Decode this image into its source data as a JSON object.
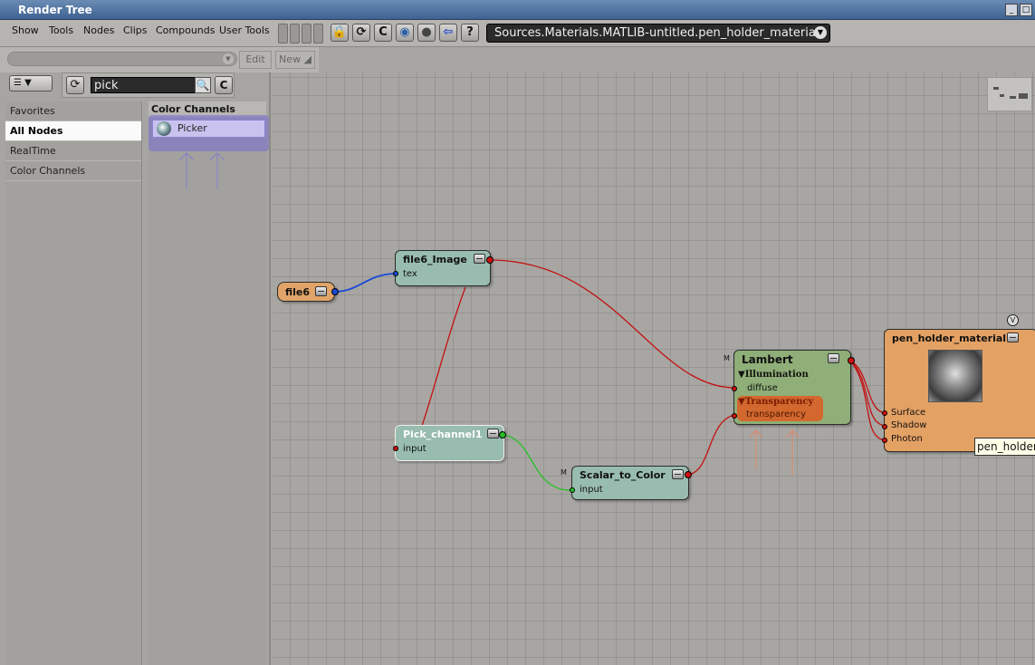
{
  "window": {
    "title": "Render Tree",
    "controls": [
      "_",
      "□"
    ]
  },
  "menu": [
    "Show",
    "Tools",
    "Nodes",
    "Clips",
    "Compounds",
    "User Tools"
  ],
  "toolbar": {
    "icons": [
      {
        "name": "lock-icon",
        "glyph": "🔒"
      },
      {
        "name": "refresh-icon",
        "glyph": "⟳"
      },
      {
        "name": "clear-icon",
        "glyph": "C"
      },
      {
        "name": "material-sphere-icon",
        "glyph": "◉"
      },
      {
        "name": "render-apple-icon",
        "glyph": "●"
      },
      {
        "name": "back-arrow-icon",
        "glyph": "⇦"
      },
      {
        "name": "help-icon",
        "glyph": "?"
      }
    ],
    "path": "Sources.Materials.MATLIB-untitled.pen_holder_material",
    "path_dropdown": "▼"
  },
  "toolbar2": {
    "edit_label": "Edit",
    "new_label": "New ◢",
    "combo_dropdown": "▼"
  },
  "preset_panel": {
    "list_mode_glyph": "☰ ▼",
    "search": {
      "value": "pick",
      "search_glyph": "🔍",
      "clear_glyph": "C",
      "refresh_glyph": "⟳"
    },
    "categories": [
      {
        "label": "Favorites",
        "selected": false
      },
      {
        "label": "All Nodes",
        "selected": true
      },
      {
        "label": "RealTime",
        "selected": false
      },
      {
        "label": "Color Channels",
        "selected": false
      }
    ],
    "node_group": {
      "header": "Color Channels",
      "items": [
        {
          "label": "Picker"
        }
      ]
    }
  },
  "graph": {
    "nodes": {
      "file6": {
        "title": "file6"
      },
      "file6_image": {
        "title": "file6_Image",
        "ports": {
          "tex": "tex"
        }
      },
      "pick_channel1": {
        "title": "Pick_channel1",
        "ports": {
          "input": "input"
        }
      },
      "scalar_to_color": {
        "title": "Scalar_to_Color",
        "ports": {
          "input": "input"
        },
        "marker": "M"
      },
      "lambert": {
        "title": "Lambert",
        "marker": "M",
        "sections": {
          "illumination": "▼Illumination",
          "transparency": "▼Transparency"
        },
        "ports": {
          "diffuse": "diffuse",
          "transparency": "transparency"
        }
      },
      "pen_holder_material": {
        "title": "pen_holder_material",
        "ports": {
          "surface": "Surface",
          "shadow": "Shadow",
          "photon": "Photon"
        },
        "view_toggle": "V"
      }
    },
    "tooltip": "pen_holder_material"
  },
  "colors": {
    "file_node": "#e0a468",
    "shader_node": "#98bcaf",
    "lambert_node": "#8fae78",
    "material_node": "#e4a164",
    "transparency_section": "#d2682e",
    "wire_red": "#c21212",
    "wire_blue": "#1a49d6",
    "wire_green": "#26c026"
  }
}
